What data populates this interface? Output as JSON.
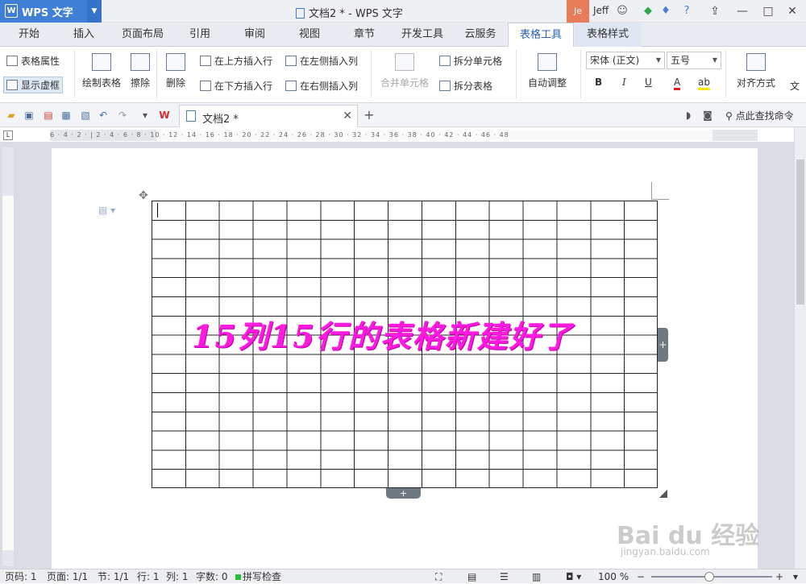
{
  "app": {
    "name": "WPS 文字",
    "logo": "W",
    "doc_title": "文档2 * - WPS 文字",
    "user_badge": "Je",
    "user_name": "Jeff"
  },
  "menu_tabs": [
    "开始",
    "插入",
    "页面布局",
    "引用",
    "审阅",
    "视图",
    "章节",
    "开发工具",
    "云服务",
    "表格工具",
    "表格样式"
  ],
  "active_tab": "表格工具",
  "ribbon": {
    "table_props": "表格属性",
    "show_gridlines": "显示虚框",
    "draw_table": "绘制表格",
    "eraser": "擦除",
    "delete": "删除",
    "insert_above": "在上方插入行",
    "insert_below": "在下方插入行",
    "insert_left": "在左侧插入列",
    "insert_right": "在右侧插入列",
    "merge_cells": "合并单元格",
    "split_cells": "拆分单元格",
    "split_table": "拆分表格",
    "autofit": "自动调整",
    "font_name": "宋体 (正文)",
    "font_size": "五号",
    "bold": "B",
    "italic": "I",
    "underline": "U",
    "font_color": "A",
    "align": "对齐方式",
    "text_dir": "文"
  },
  "doc_tab": {
    "name": "文档2 *"
  },
  "search": {
    "label": "点此查找命令"
  },
  "ruler_marks": "6 · 4 · 2 · | 2 · 4 · 6 · 8 · 10 · 12 · 14 · 16 · 18 · 20 · 22 · 24 · 26 · 28 · 30 · 32 · 34 · 36 · 38 · 40 · 42 · 44 · 46 · 48",
  "table": {
    "rows": 15,
    "cols": 15
  },
  "overlay_text": "15列15行的表格新建好了",
  "status": {
    "page_num": "页码: 1",
    "pages": "页面: 1/1",
    "section": "节: 1/1",
    "row": "行: 1",
    "col": "列: 1",
    "word_count": "字数: 0",
    "spellcheck": "拼写检查",
    "zoom": "100 %"
  },
  "watermark": {
    "brand": "Bai du 经验",
    "url": "jingyan.baidu.com"
  },
  "colors": {
    "accent": "#3f7fd6",
    "overlay": "#ff1ae0"
  }
}
